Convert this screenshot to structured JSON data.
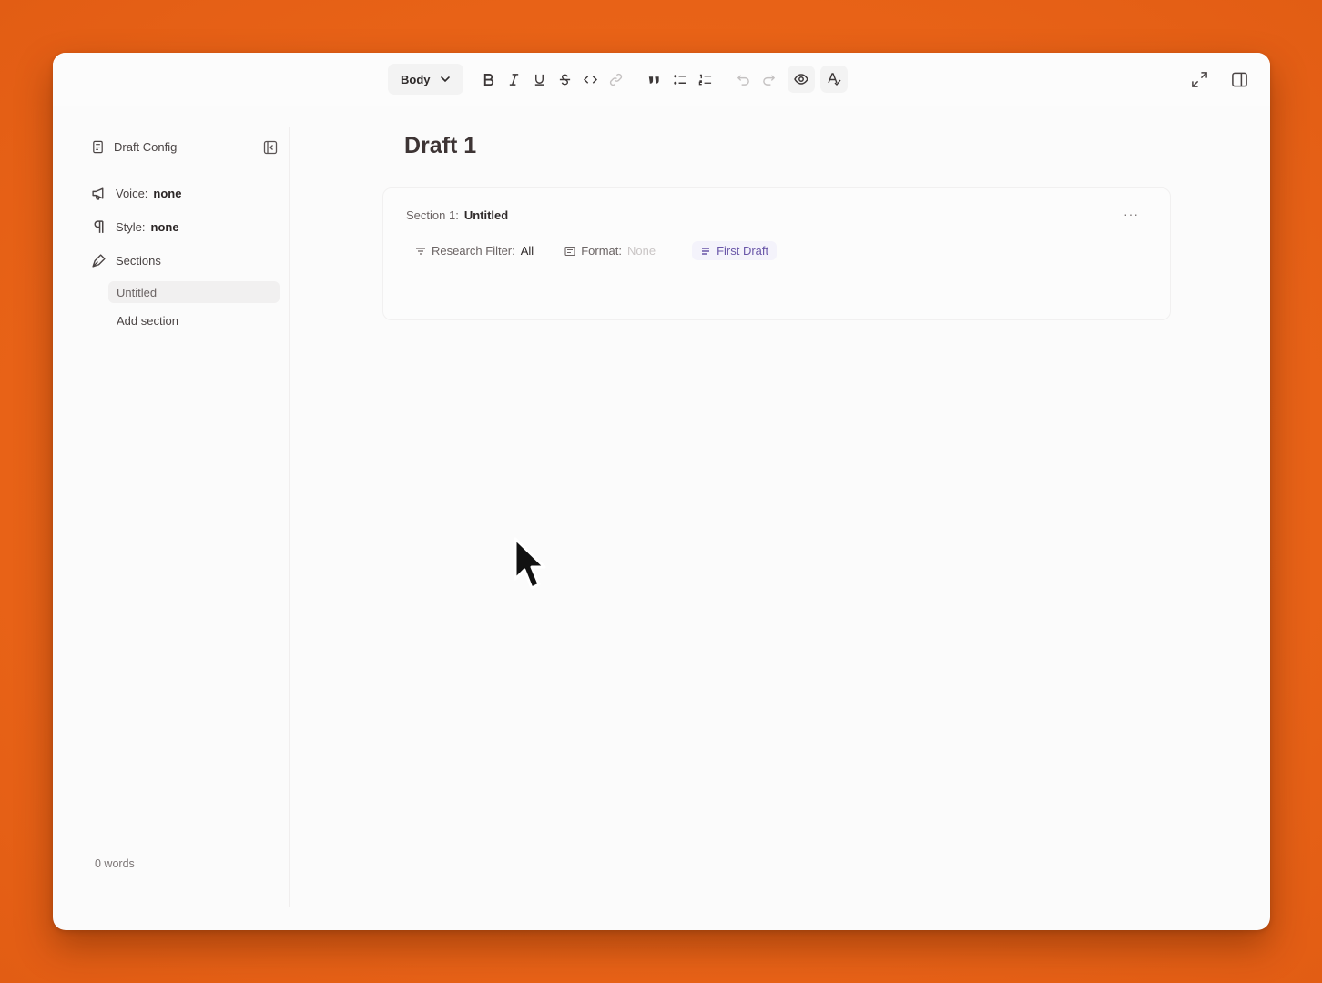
{
  "toolbar": {
    "text_style": "Body",
    "buttons": [
      "bold-icon",
      "italic-icon",
      "underline-icon",
      "strikethrough-icon",
      "code-icon",
      "link-icon",
      "quote-icon",
      "bullet-list-icon",
      "numbered-list-icon",
      "undo-icon",
      "redo-icon",
      "eye-icon",
      "spellcheck-icon"
    ]
  },
  "top_right": [
    "expand-icon",
    "panel-icon"
  ],
  "sidebar": {
    "title": "Draft Config",
    "voice_label": "Voice:",
    "voice_value": "none",
    "style_label": "Style:",
    "style_value": "none",
    "sections_label": "Sections",
    "sections": [
      "Untitled"
    ],
    "add_section": "Add section",
    "word_count": "0 words"
  },
  "document": {
    "title": "Draft 1",
    "section": {
      "prefix": "Section 1:",
      "name": "Untitled",
      "more": "···",
      "research_filter_label": "Research Filter:",
      "research_filter_value": "All",
      "format_label": "Format:",
      "format_value": "None",
      "draft_label": "First Draft"
    }
  },
  "colors": {
    "background": "#ea6418",
    "window": "#fbfbfb",
    "draft_chip_text": "#6956a8"
  }
}
